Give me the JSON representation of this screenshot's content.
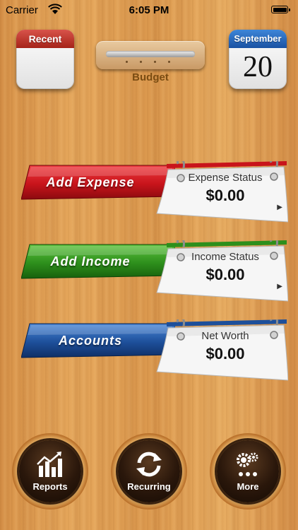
{
  "status_bar": {
    "carrier": "Carrier",
    "time": "6:05 PM"
  },
  "calendars": {
    "recent": {
      "label": "Recent"
    },
    "date": {
      "month": "September",
      "day": "20"
    }
  },
  "budget": {
    "label": "Budget"
  },
  "rows": [
    {
      "button": "Add Expense",
      "status_title": "Expense Status",
      "value": "$0.00",
      "color": "#c8141b"
    },
    {
      "button": "Add Income",
      "status_title": "Income Status",
      "value": "$0.00",
      "color": "#2d8f1c"
    },
    {
      "button": "Accounts",
      "status_title": "Net Worth",
      "value": "$0.00",
      "color": "#1d4f9a"
    }
  ],
  "bottom": {
    "reports": "Reports",
    "recurring": "Recurring",
    "more": "More"
  }
}
